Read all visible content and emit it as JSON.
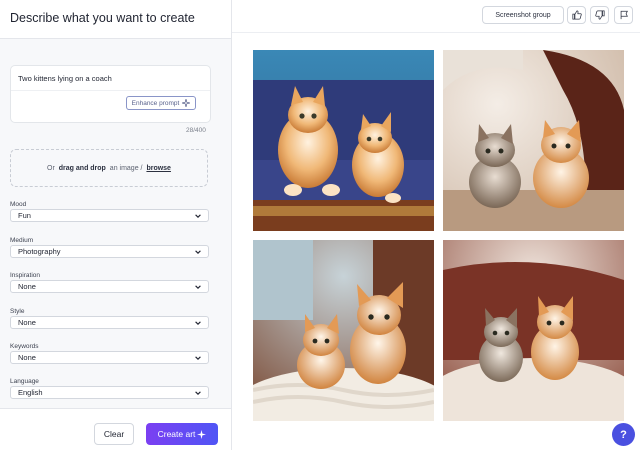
{
  "header": {
    "title": "Describe what you want to create"
  },
  "prompt": {
    "text": "Two kittens lying on a coach",
    "enhance_label": "Enhance prompt",
    "char_count": "28/400"
  },
  "upload": {
    "prefix": "Or",
    "drag_drop": "drag and drop",
    "middle": "an image /",
    "browse": "browse"
  },
  "fields": [
    {
      "label": "Mood",
      "value": "Fun"
    },
    {
      "label": "Medium",
      "value": "Photography"
    },
    {
      "label": "Inspiration",
      "value": "None"
    },
    {
      "label": "Style",
      "value": "None"
    },
    {
      "label": "Keywords",
      "value": "None"
    },
    {
      "label": "Language",
      "value": "English"
    }
  ],
  "footer": {
    "clear_label": "Clear",
    "create_label": "Create art"
  },
  "toolbar": {
    "screenshot_group_label": "Screenshot group",
    "icons": [
      "thumbs-up-icon",
      "thumbs-down-icon",
      "flag-icon"
    ]
  },
  "gallery": {
    "count": 4
  },
  "help": {
    "label": "?"
  },
  "colors": {
    "accent_start": "#7b3ff2",
    "accent_end": "#4f55f5",
    "help": "#4a50e0"
  }
}
